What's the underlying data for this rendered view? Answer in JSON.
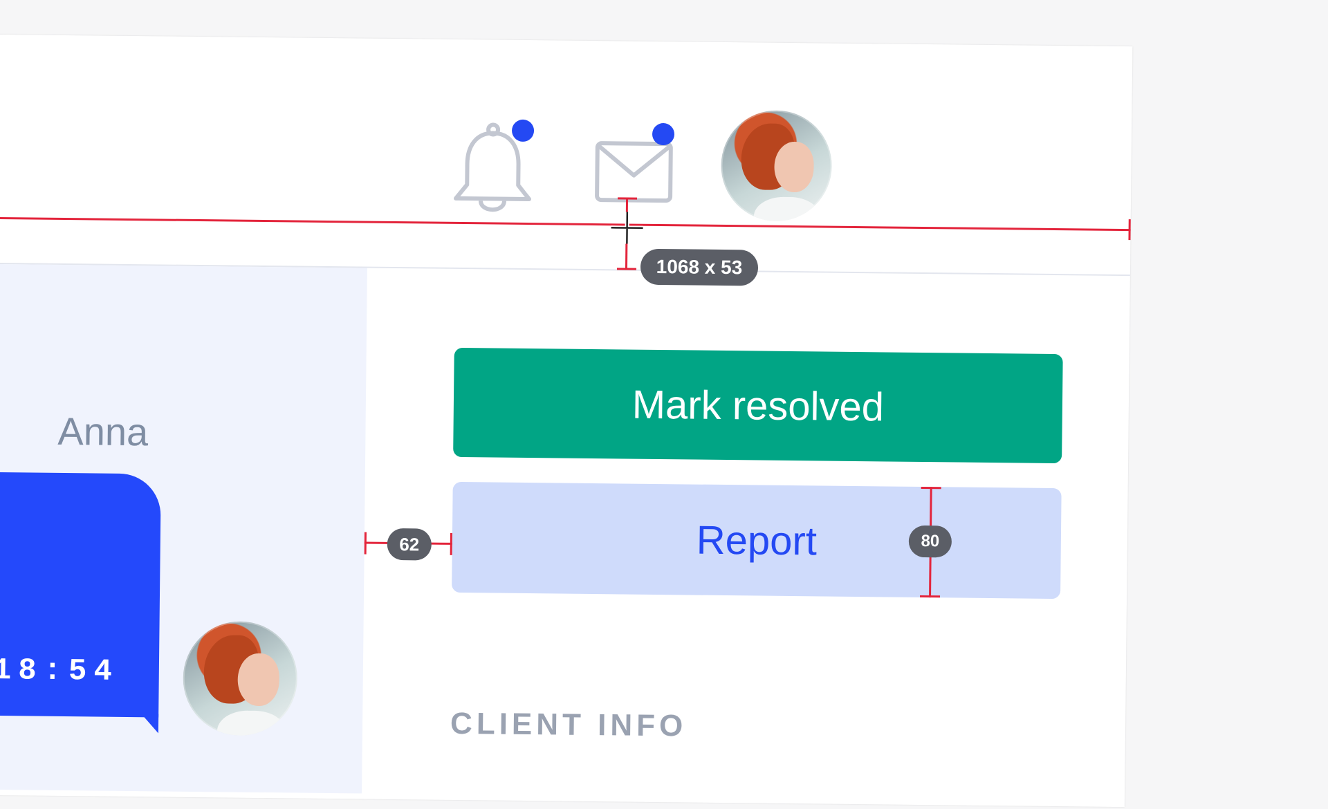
{
  "header": {
    "notifications": {
      "icon": "bell-icon",
      "has_unread": true
    },
    "messages": {
      "icon": "mail-icon",
      "has_unread": true
    },
    "profile_avatar": {
      "icon": "user-avatar"
    }
  },
  "conversation": {
    "sender_name": "Anna",
    "last_message_time": "18:54"
  },
  "actions": {
    "primary_label": "Mark resolved",
    "secondary_label": "Report"
  },
  "sidebar": {
    "client_info_heading": "CLIENT INFO"
  },
  "measurements": {
    "header_size_label": "1068 x 53",
    "gap_label": "62",
    "height_label": "80"
  },
  "colors": {
    "accent_blue": "#2449f3",
    "resolve_green": "#01a585",
    "report_bg": "#cfdbfb",
    "guide_red": "#e3243b"
  }
}
